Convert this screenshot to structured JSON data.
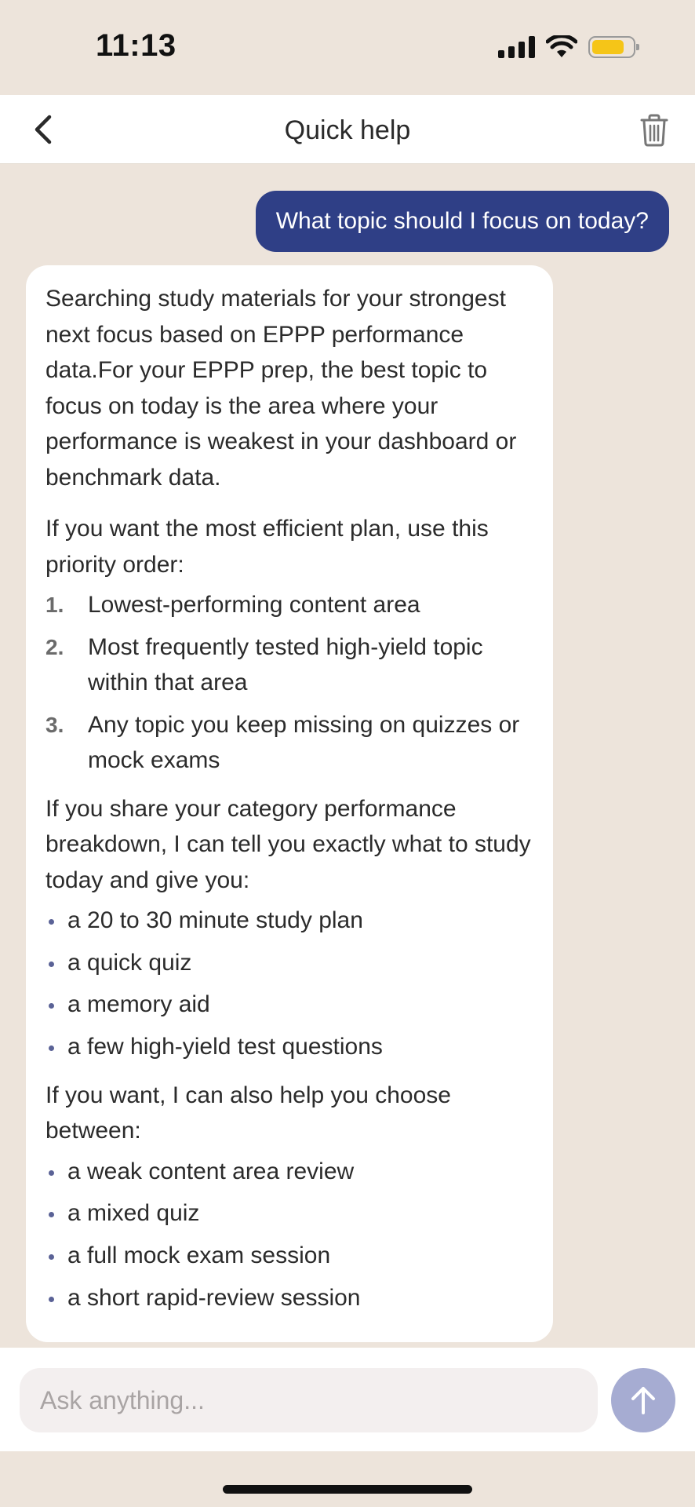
{
  "status_bar": {
    "time": "11:13"
  },
  "header": {
    "title": "Quick help"
  },
  "chat": {
    "user_message": "What topic should I focus on today?",
    "assistant": {
      "intro": "Searching study materials for your strongest next focus based on EPPP performance data.For your EPPP prep, the best topic to focus on today is the area where your performance is weakest in your dashboard or benchmark data.",
      "priority_intro": "If you want the most efficient plan, use this priority order:",
      "priority_items": [
        {
          "num": "1.",
          "text": "Lowest-performing content area"
        },
        {
          "num": "2.",
          "text": "Most frequently tested high-yield topic within that area"
        },
        {
          "num": "3.",
          "text": "Any topic you keep missing on quizzes or mock exams"
        }
      ],
      "share_intro": "If you share your category performance breakdown, I can tell you exactly what to study today and give you:",
      "share_items": [
        "a 20 to 30 minute study plan",
        "a quick quiz",
        "a memory aid",
        "a few high-yield test questions"
      ],
      "choose_intro": "If you want, I can also help you choose between:",
      "choose_items": [
        "a weak content area review",
        "a mixed quiz",
        "a full mock exam session",
        "a short rapid-review session"
      ]
    }
  },
  "composer": {
    "placeholder": "Ask anything...",
    "value": ""
  },
  "colors": {
    "background": "#ede4db",
    "user_bubble": "#2f3f86",
    "send_button": "#a6acd2",
    "battery": "#f5c518"
  },
  "icons": {
    "back": "chevron-left-icon",
    "trash": "trash-icon",
    "send": "arrow-up-icon",
    "signal": "cellular-signal-icon",
    "wifi": "wifi-icon",
    "battery": "battery-icon"
  }
}
